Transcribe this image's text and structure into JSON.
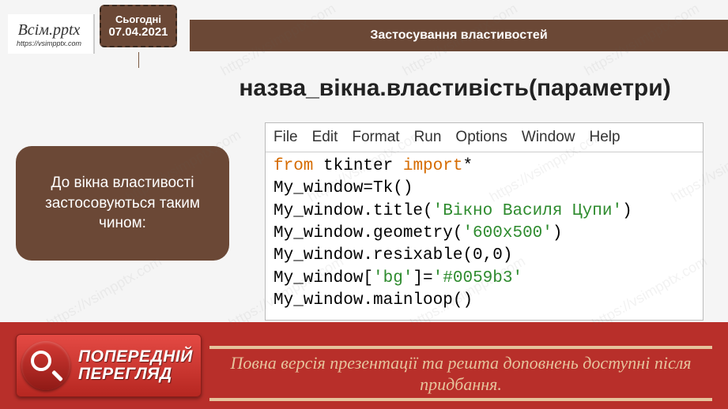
{
  "logo": {
    "main": "Всім.pptx",
    "sub": "https://vsimpptx.com"
  },
  "date_tag": {
    "today": "Сьогодні",
    "date": "07.04.2021"
  },
  "top_bar": {
    "title": "Застосування властивостей"
  },
  "heading": "назва_вікна.властивість(параметри)",
  "side_card": {
    "text": "До вікна властивості застосовуються таким чином:"
  },
  "editor": {
    "menu": [
      "File",
      "Edit",
      "Format",
      "Run",
      "Options",
      "Window",
      "Help"
    ],
    "code": {
      "l1_kw1": "from",
      "l1_mid": " tkinter ",
      "l1_kw2": "import",
      "l1_end": "*",
      "l2": "My_window=Tk()",
      "l3_a": "My_window.title(",
      "l3_b": "'Вікно Василя Цупи'",
      "l3_c": ")",
      "l4_a": "My_window.geometry(",
      "l4_b": "'600x500'",
      "l4_c": ")",
      "l5": "My_window.resixable(0,0)",
      "l6_a": "My_window[",
      "l6_b": "'bg'",
      "l6_c": "]=",
      "l6_d": "'#0059b3'",
      "l7": "My_window.mainloop()"
    }
  },
  "preview": {
    "line1": "ПОПЕРЕДНІЙ",
    "line2": "ПЕРЕГЛЯД"
  },
  "footer": {
    "msg": "Повна версія презентації та решта доповнень доступні після придбання."
  },
  "watermark": "https://vsimpptx.com"
}
